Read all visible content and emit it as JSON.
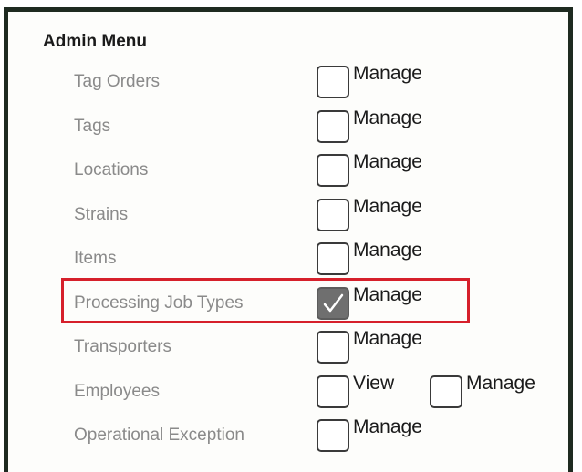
{
  "admin_menu": {
    "title": "Admin Menu",
    "rows": [
      {
        "label": "Tag Orders",
        "perms": [
          {
            "label": "Manage",
            "checked": false
          }
        ]
      },
      {
        "label": "Tags",
        "perms": [
          {
            "label": "Manage",
            "checked": false
          }
        ]
      },
      {
        "label": "Locations",
        "perms": [
          {
            "label": "Manage",
            "checked": false
          }
        ]
      },
      {
        "label": "Strains",
        "perms": [
          {
            "label": "Manage",
            "checked": false
          }
        ]
      },
      {
        "label": "Items",
        "perms": [
          {
            "label": "Manage",
            "checked": false
          }
        ]
      },
      {
        "label": "Processing Job Types",
        "perms": [
          {
            "label": "Manage",
            "checked": true
          }
        ]
      },
      {
        "label": "Transporters",
        "perms": [
          {
            "label": "Manage",
            "checked": false
          }
        ]
      },
      {
        "label": "Employees",
        "perms": [
          {
            "label": "View",
            "checked": false
          },
          {
            "label": "Manage",
            "checked": false
          }
        ]
      },
      {
        "label": "Operational Exception",
        "perms": [
          {
            "label": "Manage",
            "checked": false
          }
        ]
      }
    ],
    "highlight_color": "#d6202b",
    "checkmark_icon": "check-icon"
  }
}
